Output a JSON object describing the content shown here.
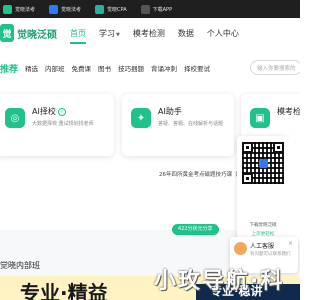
{
  "top_strip": {
    "items": [
      {
        "label": "觉晓法考",
        "color": "#1fc28a"
      },
      {
        "label": "觉晓法考",
        "color": "#2d7cf6"
      },
      {
        "label": "觉晓CPA",
        "color": "#26b3a4"
      },
      {
        "label": "下载APP",
        "color": "#555555"
      }
    ]
  },
  "header": {
    "logo_mark": "觉",
    "logo_text": "觉晓泛硕",
    "nav": [
      {
        "label": "首页",
        "active": true,
        "caret": false
      },
      {
        "label": "学习",
        "active": false,
        "caret": true
      },
      {
        "label": "模考检测",
        "active": false,
        "caret": false
      },
      {
        "label": "数据",
        "active": false,
        "caret": false
      },
      {
        "label": "个人中心",
        "active": false,
        "caret": false
      }
    ]
  },
  "subnav": {
    "highlight": "推荐",
    "items": [
      "精选",
      "内部班",
      "免费课",
      "图书",
      "技巧捆题",
      "背诵冲刺",
      "择校要试"
    ],
    "search_placeholder": "输入你要搜索的"
  },
  "cards": [
    {
      "title": "AI择校",
      "subtitle": "大数据择校 重试规划找老师",
      "icon": "ai-school-icon",
      "verified": true
    },
    {
      "title": "AI助手",
      "subtitle": "答疑、答题、在线解析与话题",
      "icon": "ai-assistant-icon",
      "verified": false
    },
    {
      "title": "模考检",
      "subtitle": "",
      "icon": "mock-exam-icon",
      "verified": false
    }
  ],
  "headline": "26年四所黄金考点磁题技巧课（适论",
  "qr": {
    "line1": "下载觉晓泛硕",
    "line2": "上岸更轻松"
  },
  "pill": "422分状元分享",
  "chat": {
    "title": "人工客服",
    "subtitle": "有问题可以联系我们",
    "close": "×"
  },
  "section_title": "觉晓内部班",
  "banner": {
    "left": "专业·精益",
    "right": "专业·稳讲"
  },
  "watermark": "小玫导航·科",
  "colors": {
    "brand": "#1fc28a",
    "topbar": "#1f1f1f"
  }
}
